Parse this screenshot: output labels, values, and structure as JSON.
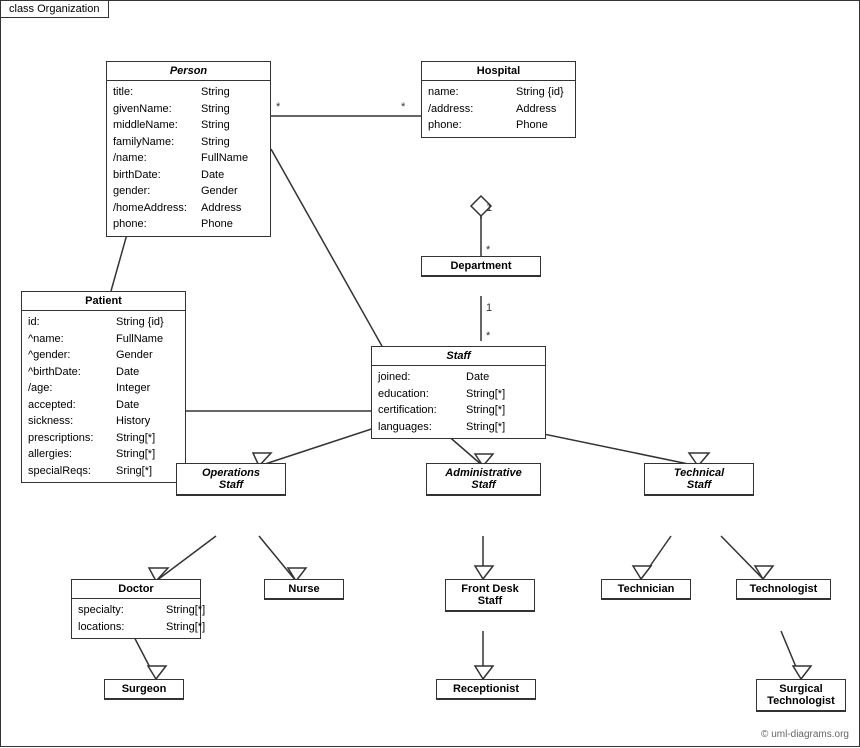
{
  "diagram": {
    "title": "class Organization",
    "copyright": "© uml-diagrams.org",
    "classes": {
      "person": {
        "name": "Person",
        "italic": true,
        "attrs": [
          {
            "name": "title:",
            "type": "String"
          },
          {
            "name": "givenName:",
            "type": "String"
          },
          {
            "name": "middleName:",
            "type": "String"
          },
          {
            "name": "familyName:",
            "type": "String"
          },
          {
            "name": "/name:",
            "type": "FullName"
          },
          {
            "name": "birthDate:",
            "type": "Date"
          },
          {
            "name": "gender:",
            "type": "Gender"
          },
          {
            "name": "/homeAddress:",
            "type": "Address"
          },
          {
            "name": "phone:",
            "type": "Phone"
          }
        ]
      },
      "hospital": {
        "name": "Hospital",
        "italic": false,
        "attrs": [
          {
            "name": "name:",
            "type": "String {id}"
          },
          {
            "name": "/address:",
            "type": "Address"
          },
          {
            "name": "phone:",
            "type": "Phone"
          }
        ]
      },
      "patient": {
        "name": "Patient",
        "italic": false,
        "attrs": [
          {
            "name": "id:",
            "type": "String {id}"
          },
          {
            "name": "^name:",
            "type": "FullName"
          },
          {
            "name": "^gender:",
            "type": "Gender"
          },
          {
            "name": "^birthDate:",
            "type": "Date"
          },
          {
            "name": "/age:",
            "type": "Integer"
          },
          {
            "name": "accepted:",
            "type": "Date"
          },
          {
            "name": "sickness:",
            "type": "History"
          },
          {
            "name": "prescriptions:",
            "type": "String[*]"
          },
          {
            "name": "allergies:",
            "type": "String[*]"
          },
          {
            "name": "specialReqs:",
            "type": "Sring[*]"
          }
        ]
      },
      "department": {
        "name": "Department",
        "italic": false,
        "attrs": []
      },
      "staff": {
        "name": "Staff",
        "italic": true,
        "attrs": [
          {
            "name": "joined:",
            "type": "Date"
          },
          {
            "name": "education:",
            "type": "String[*]"
          },
          {
            "name": "certification:",
            "type": "String[*]"
          },
          {
            "name": "languages:",
            "type": "String[*]"
          }
        ]
      },
      "operationsStaff": {
        "name": "Operations\nStaff",
        "italic": true,
        "attrs": []
      },
      "administrativeStaff": {
        "name": "Administrative\nStaff",
        "italic": true,
        "attrs": []
      },
      "technicalStaff": {
        "name": "Technical\nStaff",
        "italic": true,
        "attrs": []
      },
      "doctor": {
        "name": "Doctor",
        "italic": false,
        "attrs": [
          {
            "name": "specialty:",
            "type": "String[*]"
          },
          {
            "name": "locations:",
            "type": "String[*]"
          }
        ]
      },
      "nurse": {
        "name": "Nurse",
        "italic": false,
        "attrs": []
      },
      "frontDeskStaff": {
        "name": "Front Desk\nStaff",
        "italic": false,
        "attrs": []
      },
      "technician": {
        "name": "Technician",
        "italic": false,
        "attrs": []
      },
      "technologist": {
        "name": "Technologist",
        "italic": false,
        "attrs": []
      },
      "surgeon": {
        "name": "Surgeon",
        "italic": false,
        "attrs": []
      },
      "receptionist": {
        "name": "Receptionist",
        "italic": false,
        "attrs": []
      },
      "surgicalTechnologist": {
        "name": "Surgical\nTechnologist",
        "italic": false,
        "attrs": []
      }
    }
  }
}
